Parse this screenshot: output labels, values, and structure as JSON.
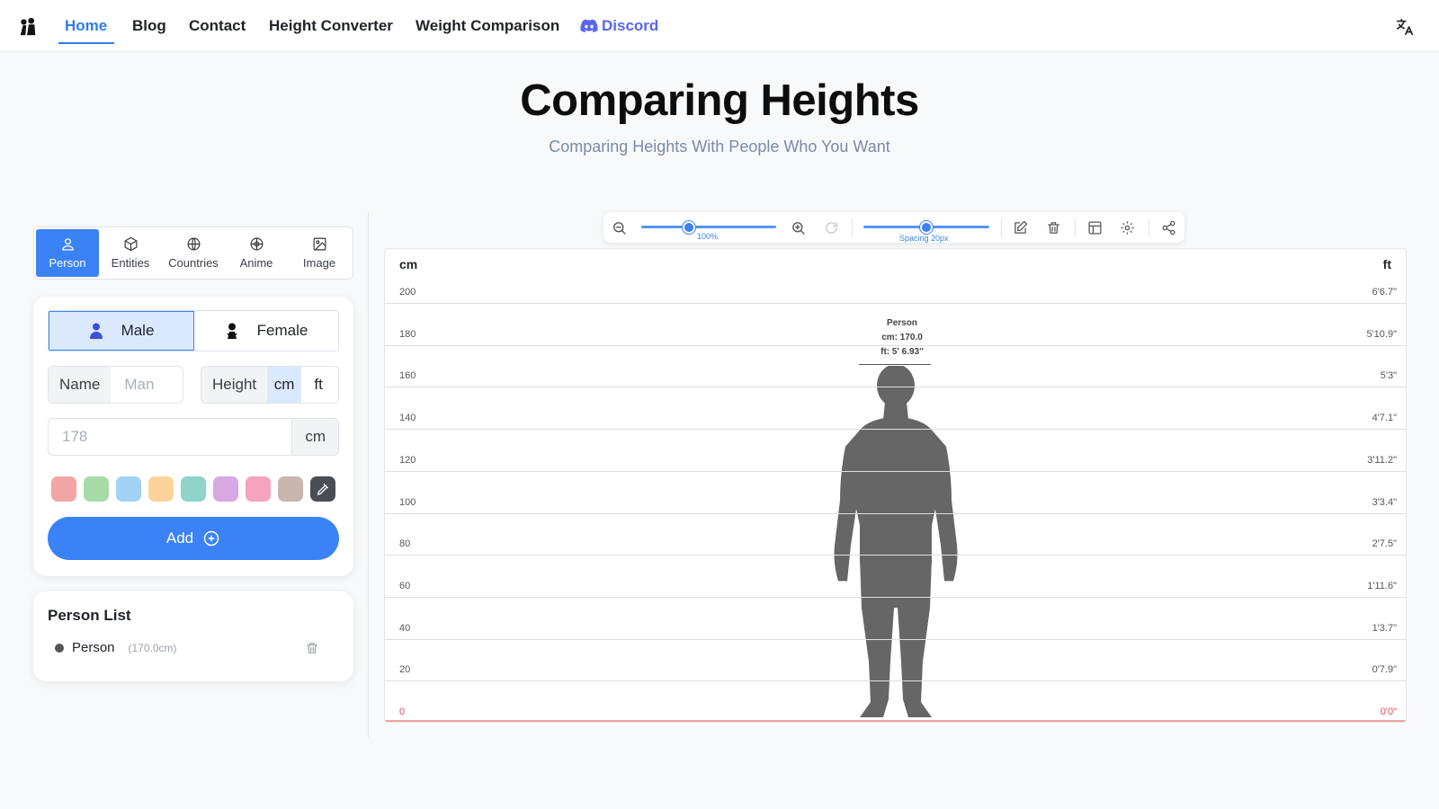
{
  "nav": {
    "links": [
      "Home",
      "Blog",
      "Contact",
      "Height Converter",
      "Weight Comparison"
    ],
    "discord": "Discord",
    "active": "Home"
  },
  "hero": {
    "title": "Comparing Heights",
    "subtitle": "Comparing Heights With People Who You Want"
  },
  "tabs": [
    {
      "label": "Person",
      "icon": "person-icon",
      "active": true
    },
    {
      "label": "Entities",
      "icon": "cube-icon"
    },
    {
      "label": "Countries",
      "icon": "globe-icon"
    },
    {
      "label": "Anime",
      "icon": "anime-globe-icon"
    },
    {
      "label": "Image",
      "icon": "image-icon"
    }
  ],
  "form": {
    "gender": {
      "male": "Male",
      "female": "Female",
      "selected": "Male"
    },
    "name_label": "Name",
    "name_placeholder": "Man",
    "height_label": "Height",
    "unit_cm": "cm",
    "unit_ft": "ft",
    "height_placeholder": "178",
    "height_unit": "cm",
    "colors": [
      "#f2a5a5",
      "#a8dba8",
      "#a3d2f7",
      "#fcd49a",
      "#8fd3c9",
      "#d7a8e3",
      "#f5a3bf",
      "#c9b6ad"
    ],
    "add_label": "Add"
  },
  "person_list": {
    "title": "Person List",
    "items": [
      {
        "name": "Person",
        "size": "(170.0cm)"
      }
    ]
  },
  "toolbar": {
    "zoom_label": "100%",
    "zoom_level": 0.35,
    "spacing_label": "Spacing 20px",
    "spacing_level": 0.5
  },
  "chart_data": {
    "type": "height-comparison",
    "left_unit": "cm",
    "right_unit": "ft",
    "ticks_cm": [
      "200",
      "180",
      "160",
      "140",
      "120",
      "100",
      "80",
      "60",
      "40",
      "20",
      "0"
    ],
    "ticks_ft": [
      "6'6.7\"",
      "5'10.9\"",
      "5'3\"",
      "4'7.1\"",
      "3'11.2\"",
      "3'3.4\"",
      "2'7.5\"",
      "1'11.6\"",
      "1'3.7\"",
      "0'7.9\"",
      "0'0\""
    ],
    "ylim": [
      0,
      200
    ],
    "people": [
      {
        "name": "Person",
        "cm_label": "cm: 170.0",
        "ft_label": "ft: 5' 6.93''",
        "height_cm": 170.0,
        "color": "#666666",
        "gender": "male"
      }
    ]
  }
}
